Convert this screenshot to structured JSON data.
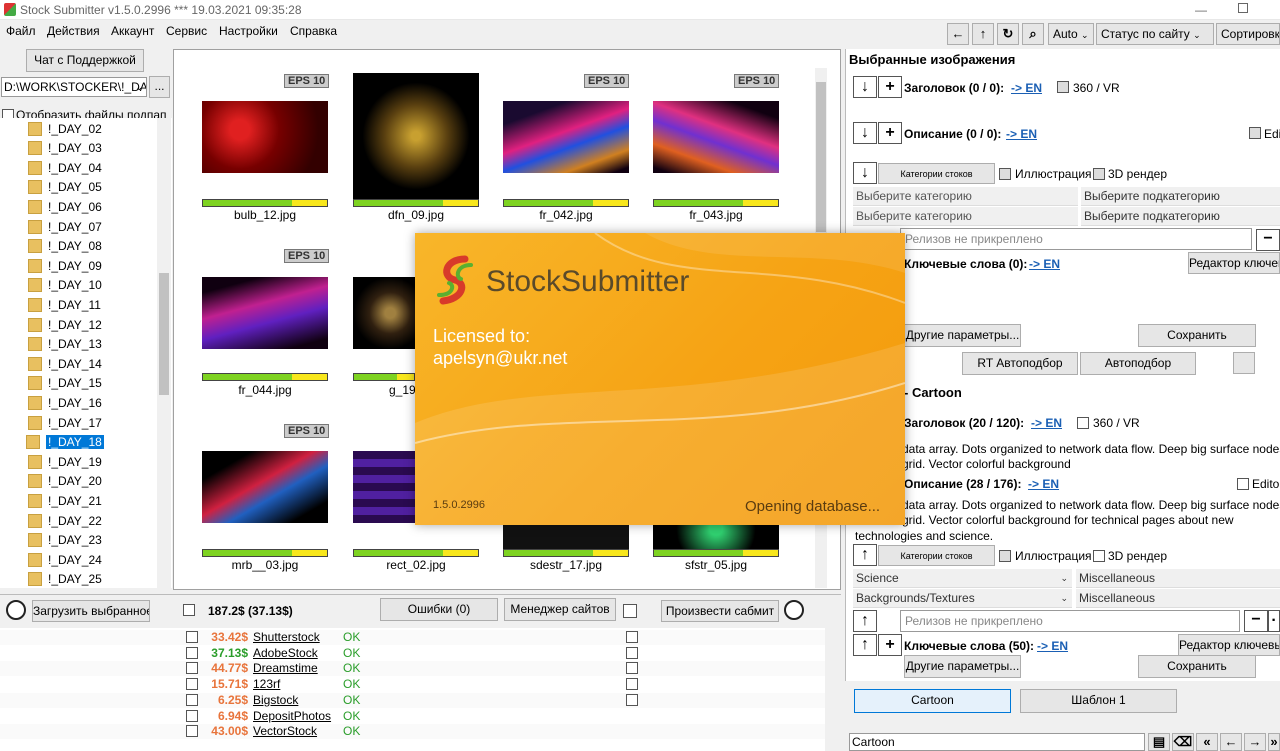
{
  "title_bar": {
    "text": "Stock Submitter v1.5.0.2996 ***  19.03.2021 09:35:28"
  },
  "menu": [
    "Файл",
    "Действия",
    "Аккаунт",
    "Сервис",
    "Настройки",
    "Справка"
  ],
  "toolbar": {
    "auto": "Auto",
    "status": "Статус по сайту",
    "sort": "Сортировк"
  },
  "left": {
    "support_btn": "Чат с Поддержкой",
    "path": "D:\\WORK\\STOCKER\\!_DA",
    "browse": "...",
    "show_sub": "Отобразить файлы подпап",
    "folders": [
      "!_DAY_02",
      "!_DAY_03",
      "!_DAY_04",
      "!_DAY_05",
      "!_DAY_06",
      "!_DAY_07",
      "!_DAY_08",
      "!_DAY_09",
      "!_DAY_10",
      "!_DAY_11",
      "!_DAY_12",
      "!_DAY_13",
      "!_DAY_14",
      "!_DAY_15",
      "!_DAY_16",
      "!_DAY_17",
      "!_DAY_18",
      "!_DAY_19",
      "!_DAY_20",
      "!_DAY_21",
      "!_DAY_22",
      "!_DAY_23",
      "!_DAY_24",
      "!_DAY_25"
    ]
  },
  "gallery": {
    "eps": "EPS 10",
    "items": [
      {
        "name": "bulb_12.jpg"
      },
      {
        "name": "dfn_09.jpg"
      },
      {
        "name": "fr_042.jpg"
      },
      {
        "name": "fr_043.jpg"
      },
      {
        "name": "fr_044.jpg"
      },
      {
        "name": "g_19"
      },
      {
        "name": "mrb__03.jpg"
      },
      {
        "name": "rect_02.jpg"
      },
      {
        "name": "sdestr_17.jpg"
      },
      {
        "name": "sfstr_05.jpg"
      }
    ]
  },
  "bottom": {
    "upload": "Загрузить выбранное",
    "total": "187.2$ (37.13$)",
    "errors": "Ошибки (0)",
    "site_manager": "Менеджер сайтов",
    "submit": "Произвести сабмит",
    "sites": [
      {
        "price": "33.42$",
        "name": "Shutterstock",
        "status": "OK",
        "color": "#e8743b"
      },
      {
        "price": "37.13$",
        "name": "AdobeStock",
        "status": "OK",
        "color": "#2a9d2a"
      },
      {
        "price": "44.77$",
        "name": "Dreamstime",
        "status": "OK",
        "color": "#e8743b"
      },
      {
        "price": "15.71$",
        "name": "123rf",
        "status": "OK",
        "color": "#e8743b"
      },
      {
        "price": "6.25$",
        "name": "Bigstock",
        "status": "OK",
        "color": "#e8743b"
      },
      {
        "price": "6.94$",
        "name": "DepositPhotos",
        "status": "OK",
        "color": "#e8743b"
      },
      {
        "price": "43.00$",
        "name": "VectorStock",
        "status": "OK",
        "color": "#e8743b"
      }
    ]
  },
  "right": {
    "header": "Выбранные изображения",
    "title_lbl": "Заголовок (0 / 0):",
    "desc_lbl": "Описание (0 / 0):",
    "en": "-> EN",
    "vr": "360 / VR",
    "edit": "Edi",
    "categories_btn": "Категории стоков",
    "illustration": "Иллюстрация",
    "render3d": "3D рендер",
    "choose_cat": "Выберите категорию",
    "choose_subcat": "Выберите подкатегорию",
    "releases": "Релизов не прикреплено",
    "keywords_lbl": "Ключевые слова (0):",
    "kw_editor": "Редактор ключев",
    "other_params": "Другие параметры...",
    "save": "Сохранить",
    "rt_auto": "RT Автоподбор",
    "auto": "Автоподбор",
    "section2": "- Cartoon",
    "title2_lbl": "Заголовок (20 / 120):",
    "title2_text_a": "data array. Dots organized to network data flow. Deep big surface nodes",
    "title2_text_b": "grid. Vector colorful background",
    "desc2_lbl": "Описание (28 / 176):",
    "edito": "Edito",
    "desc2_text_a": "data array. Dots organized to network data flow. Deep big surface nodes",
    "desc2_text_b": "grid. Vector colorful background for technical pages about new",
    "desc2_text_c": "technologies and science.",
    "cat1": "Science",
    "cat1b": "Miscellaneous",
    "cat2": "Backgrounds/Textures",
    "cat2b": "Miscellaneous",
    "keywords2_lbl": "Ключевые слова (50):",
    "kw_editor2": "Редактор ключевы",
    "tab_cartoon": "Cartoon",
    "tab_template": "Шаблон 1",
    "footer_field": "Cartoon"
  },
  "splash": {
    "logo_text": "StockSubmitter",
    "licensed": "Licensed to:",
    "email": "apelsyn@ukr.net",
    "version": "1.5.0.2996",
    "status": "Opening database..."
  }
}
